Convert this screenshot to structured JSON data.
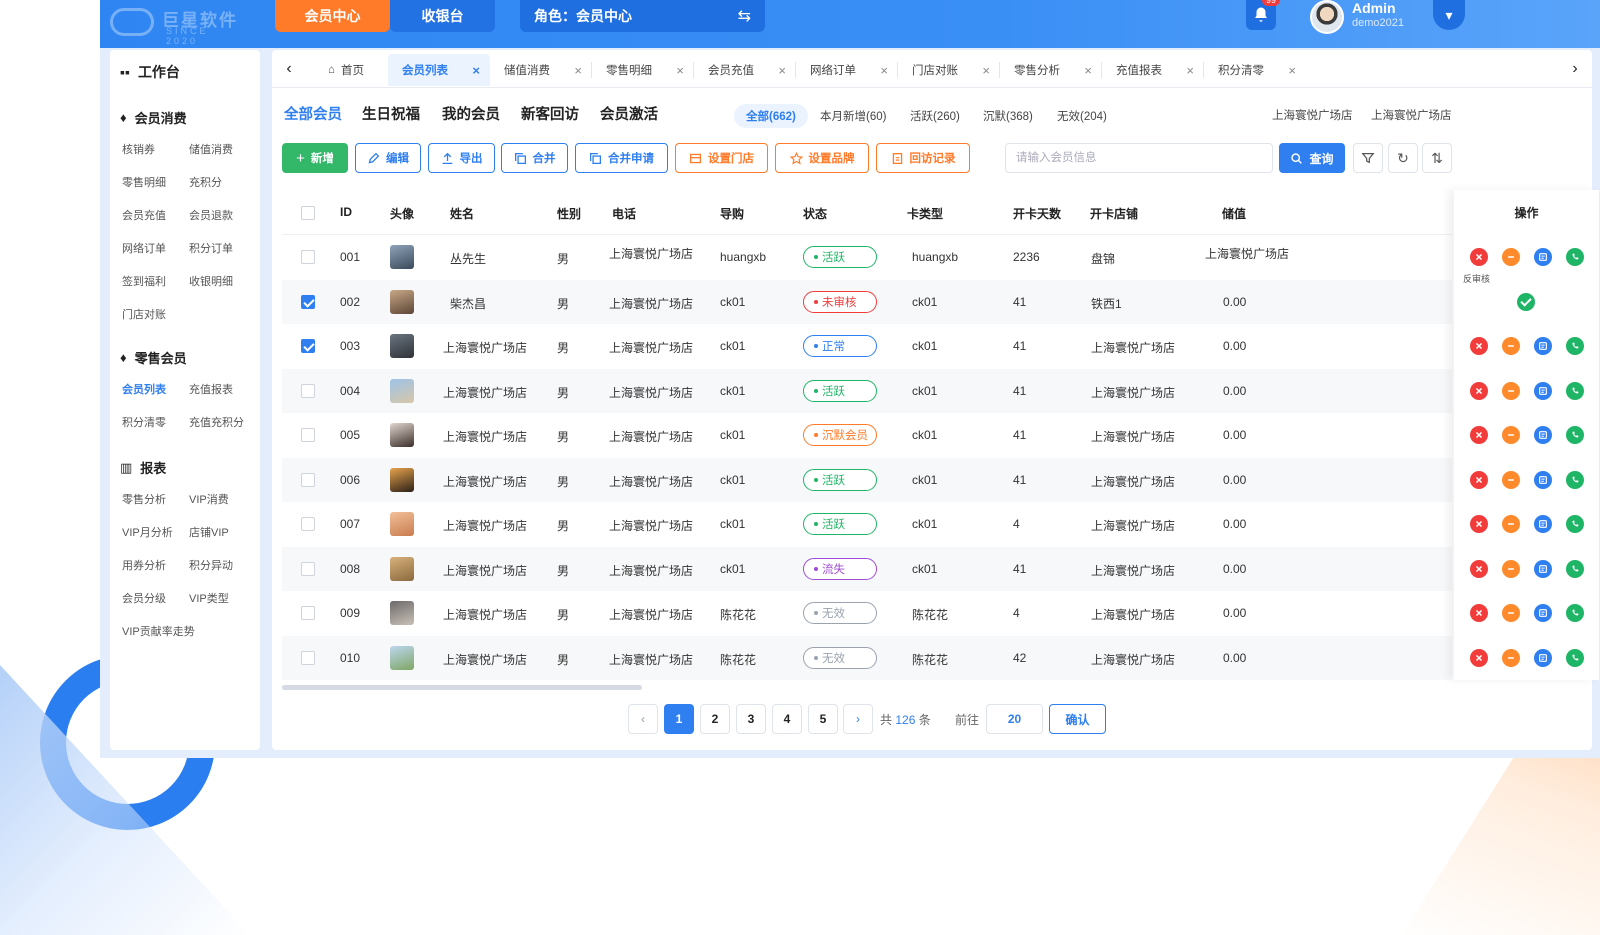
{
  "header": {
    "logo_text": "巨星软件",
    "logo_sub": "SINCE 2020",
    "nav_member": "会员中心",
    "nav_cashier": "收银台",
    "role": "角色：会员中心",
    "bell_count": "99",
    "admin_name": "Admin",
    "admin_sub": "demo2021"
  },
  "sidebar": {
    "title": "工作台",
    "sections": [
      {
        "title": "会员消费",
        "items": [
          "核销券",
          "储值消费",
          "零售明细",
          "充积分",
          "会员充值",
          "会员退款",
          "网络订单",
          "积分订单",
          "签到福利",
          "收银明细",
          "门店对账"
        ]
      },
      {
        "title": "零售会员",
        "items": [
          "会员列表",
          "充值报表",
          "积分清零",
          "充值充积分"
        ],
        "active": "会员列表"
      },
      {
        "title": "报表",
        "items": [
          "零售分析",
          "VIP消费",
          "VIP月分析",
          "店铺VIP",
          "用券分析",
          "积分异动",
          "会员分级",
          "VIP类型",
          "VIP贡献率走势"
        ]
      }
    ]
  },
  "tabs": [
    "首页",
    "会员列表",
    "储值消费",
    "零售明细",
    "会员充值",
    "网络订单",
    "门店对账",
    "零售分析",
    "充值报表",
    "积分清零"
  ],
  "active_tab": "会员列表",
  "subnav": [
    "全部会员",
    "生日祝福",
    "我的会员",
    "新客回访",
    "会员激活"
  ],
  "filters": [
    "全部(662)",
    "本月新增(60)",
    "活跃(260)",
    "沉默(368)",
    "无效(204)"
  ],
  "stores": [
    "上海寰悦广场店",
    "上海寰悦广场店"
  ],
  "toolbar": {
    "add": "新增",
    "edit": "编辑",
    "export": "导出",
    "merge": "合并",
    "merge_apply": "合并申请",
    "set_store": "设置门店",
    "set_brand": "设置品牌",
    "visit_record": "回访记录",
    "search_placeholder": "请输入会员信息",
    "query": "查询"
  },
  "table": {
    "columns": [
      "ID",
      "头像",
      "姓名",
      "性别",
      "电话",
      "导购",
      "状态",
      "卡类型",
      "开卡天数",
      "开卡店铺",
      "储值",
      "操作"
    ],
    "rows": [
      {
        "id": "001",
        "name": "丛先生",
        "gender": "男",
        "phone": "上海寰悦广场店",
        "guide": "huangxb",
        "status": "活跃",
        "card": "huangxb",
        "days": "2236",
        "shop": "盘锦",
        "balance": "上海寰悦广场店",
        "checked": false
      },
      {
        "id": "002",
        "name": "柴杰昌",
        "gender": "男",
        "phone": "上海寰悦广场店",
        "guide": "ck01",
        "status": "未审核",
        "card": "ck01",
        "days": "41",
        "shop": "铁西1",
        "balance": "0.00",
        "checked": true
      },
      {
        "id": "003",
        "name": "上海寰悦广场店",
        "gender": "男",
        "phone": "上海寰悦广场店",
        "guide": "ck01",
        "status": "正常",
        "card": "ck01",
        "days": "41",
        "shop": "上海寰悦广场店",
        "balance": "0.00",
        "checked": true
      },
      {
        "id": "004",
        "name": "上海寰悦广场店",
        "gender": "男",
        "phone": "上海寰悦广场店",
        "guide": "ck01",
        "status": "活跃",
        "card": "ck01",
        "days": "41",
        "shop": "上海寰悦广场店",
        "balance": "0.00",
        "checked": false
      },
      {
        "id": "005",
        "name": "上海寰悦广场店",
        "gender": "男",
        "phone": "上海寰悦广场店",
        "guide": "ck01",
        "status": "沉默会员",
        "card": "ck01",
        "days": "41",
        "shop": "上海寰悦广场店",
        "balance": "0.00",
        "checked": false
      },
      {
        "id": "006",
        "name": "上海寰悦广场店",
        "gender": "男",
        "phone": "上海寰悦广场店",
        "guide": "ck01",
        "status": "活跃",
        "card": "ck01",
        "days": "41",
        "shop": "上海寰悦广场店",
        "balance": "0.00",
        "checked": false
      },
      {
        "id": "007",
        "name": "上海寰悦广场店",
        "gender": "男",
        "phone": "上海寰悦广场店",
        "guide": "ck01",
        "status": "活跃",
        "card": "ck01",
        "days": "4",
        "shop": "上海寰悦广场店",
        "balance": "0.00",
        "checked": false
      },
      {
        "id": "008",
        "name": "上海寰悦广场店",
        "gender": "男",
        "phone": "上海寰悦广场店",
        "guide": "ck01",
        "status": "流失",
        "card": "ck01",
        "days": "41",
        "shop": "上海寰悦广场店",
        "balance": "0.00",
        "checked": false
      },
      {
        "id": "009",
        "name": "上海寰悦广场店",
        "gender": "男",
        "phone": "上海寰悦广场店",
        "guide": "陈花花",
        "status": "无效",
        "card": "陈花花",
        "days": "4",
        "shop": "上海寰悦广场店",
        "balance": "0.00",
        "checked": false
      },
      {
        "id": "010",
        "name": "上海寰悦广场店",
        "gender": "男",
        "phone": "上海寰悦广场店",
        "guide": "陈花花",
        "status": "无效",
        "card": "陈花花",
        "days": "42",
        "shop": "上海寰悦广场店",
        "balance": "0.00",
        "checked": false
      }
    ],
    "ops_tip": "反审核"
  },
  "status_colors": {
    "活跃": "#1fb566",
    "未审核": "#f23c3c",
    "正常": "#2f7ff0",
    "沉默会员": "#ff7a29",
    "流失": "#a04bd4",
    "无效": "#9aa3ae"
  },
  "pagination": {
    "pages": [
      "1",
      "2",
      "3",
      "4",
      "5"
    ],
    "active": "1",
    "total_prefix": "共",
    "total": "126",
    "total_suffix": "条",
    "goto_label": "前往",
    "goto_value": "20",
    "confirm": "确认"
  }
}
